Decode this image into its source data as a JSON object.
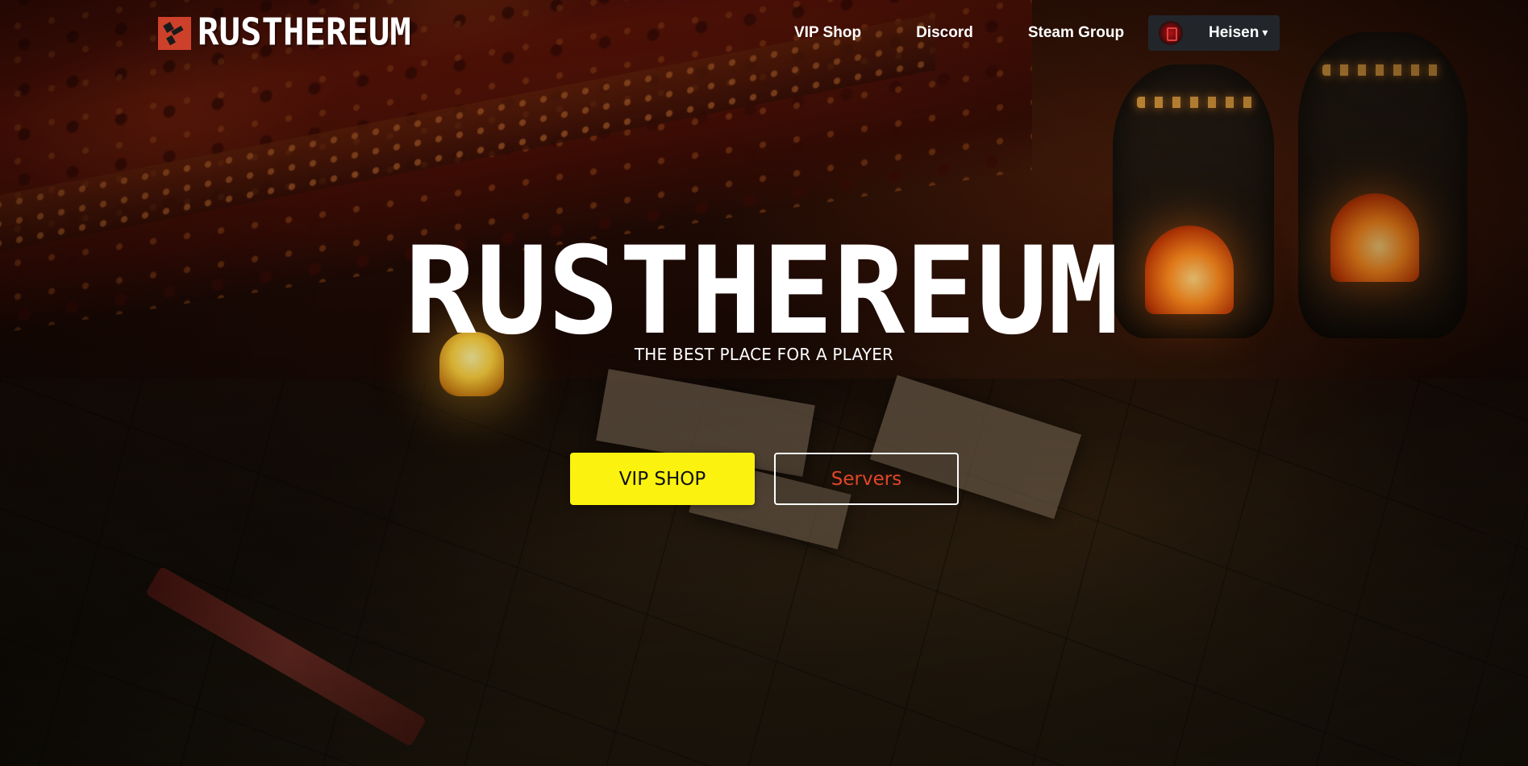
{
  "header": {
    "logo_text": "RUSTHEREUM",
    "nav": {
      "vip_shop": "VIP Shop",
      "discord": "Discord",
      "steam_group": "Steam Group"
    },
    "user": {
      "name": "Heisen",
      "caret": "▾"
    }
  },
  "hero": {
    "title": "RUSTHEREUM",
    "subtitle": "THE BEST PLACE FOR A PLAYER",
    "primary_button": "VIP SHOP",
    "secondary_button": "Servers"
  },
  "colors": {
    "brand_red": "#cd412b",
    "accent_yellow": "#fbf20f",
    "servers_text": "#e0462a",
    "user_menu_bg": "#22262b"
  },
  "icons": {
    "logo": "rust-logo-icon",
    "avatar": "user-avatar",
    "caret": "chevron-down-icon"
  }
}
